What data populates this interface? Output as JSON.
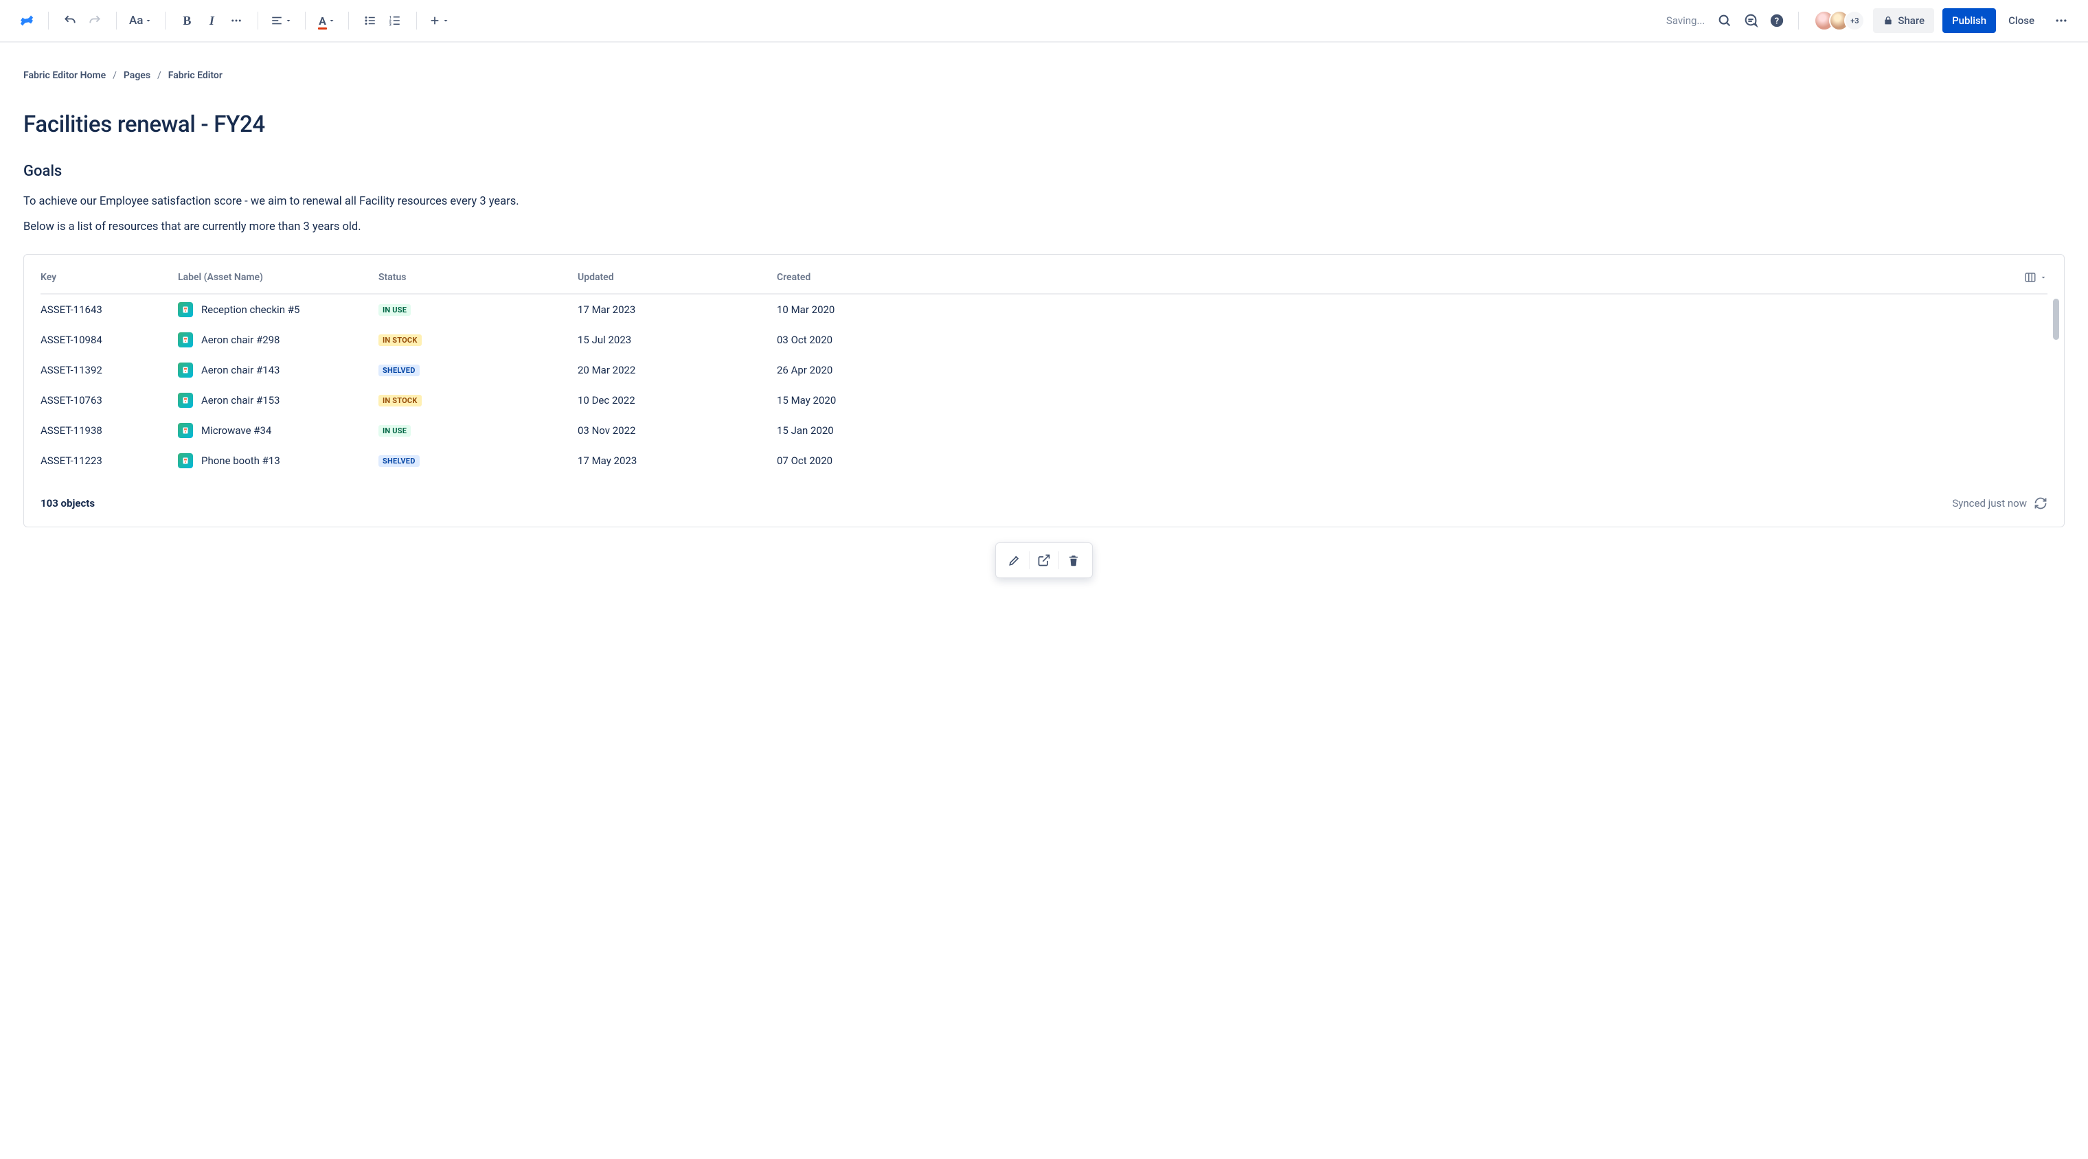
{
  "toolbar": {
    "saving": "Saving...",
    "text_styles_label": "Aa",
    "avatar_more": "+3",
    "share_label": "Share",
    "publish_label": "Publish",
    "close_label": "Close"
  },
  "breadcrumbs": [
    "Fabric Editor Home",
    "Pages",
    "Fabric Editor"
  ],
  "doc": {
    "title": "Facilities renewal - FY24",
    "h2": "Goals",
    "p1": "To achieve our Employee satisfaction score - we aim to renewal all Facility resources every 3 years.",
    "p2": "Below is a list of resources that are currently more than 3 years old."
  },
  "table": {
    "columns": {
      "key": "Key",
      "label": "Label (Asset Name)",
      "status": "Status",
      "updated": "Updated",
      "created": "Created"
    },
    "rows": [
      {
        "key": "ASSET-11643",
        "label": "Reception checkin #5",
        "status": "IN USE",
        "status_class": "inuse",
        "updated": "17 Mar 2023",
        "created": "10 Mar 2020"
      },
      {
        "key": "ASSET-10984",
        "label": "Aeron chair #298",
        "status": "IN STOCK",
        "status_class": "instock",
        "updated": "15 Jul 2023",
        "created": "03 Oct 2020"
      },
      {
        "key": "ASSET-11392",
        "label": "Aeron chair #143",
        "status": "SHELVED",
        "status_class": "shelved",
        "updated": "20 Mar 2022",
        "created": "26 Apr 2020"
      },
      {
        "key": "ASSET-10763",
        "label": "Aeron chair #153",
        "status": "IN STOCK",
        "status_class": "instock",
        "updated": "10 Dec 2022",
        "created": "15 May 2020"
      },
      {
        "key": "ASSET-11938",
        "label": "Microwave #34",
        "status": "IN USE",
        "status_class": "inuse",
        "updated": "03 Nov 2022",
        "created": "15 Jan 2020"
      },
      {
        "key": "ASSET-11223",
        "label": "Phone booth #13",
        "status": "SHELVED",
        "status_class": "shelved",
        "updated": "17 May 2023",
        "created": "07 Oct 2020"
      }
    ],
    "count": "103 objects",
    "sync": "Synced just now"
  }
}
